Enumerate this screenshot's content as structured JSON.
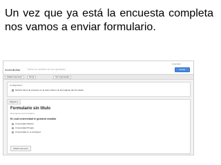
{
  "caption": "Un vez que ya está la encuesta completa nos vamos a enviar formulario.",
  "screenshot": {
    "status_text": "Guardado",
    "menu": {
      "file": "Archivo",
      "edit": "Editar",
      "view": "Ver",
      "insert": "Insertar",
      "responses": "Respuestas",
      "tools": "Herramientas",
      "help": "Ayuda",
      "hint": "Todos los cambios se han guardado"
    },
    "send_button": "Enviar formulario",
    "toolbar": {
      "add_item": "Añadir elemento",
      "theme": "Tema",
      "see_responses": "Ver respuestas"
    },
    "settings": {
      "header": "Configuración",
      "progress_label": "Mostrar barra de progreso en la parte inferior de las páginas del formulario"
    },
    "form": {
      "tab": "Página 1",
      "title": "Formulario sin título",
      "description": "Descripción del formulario",
      "question": "En cuál universidad te gustaría estudiar",
      "options": [
        "Universidad Pública",
        "Universidad Privada",
        "Universidad en el extranjero"
      ],
      "add_item_button": "Añadir elemento"
    }
  }
}
